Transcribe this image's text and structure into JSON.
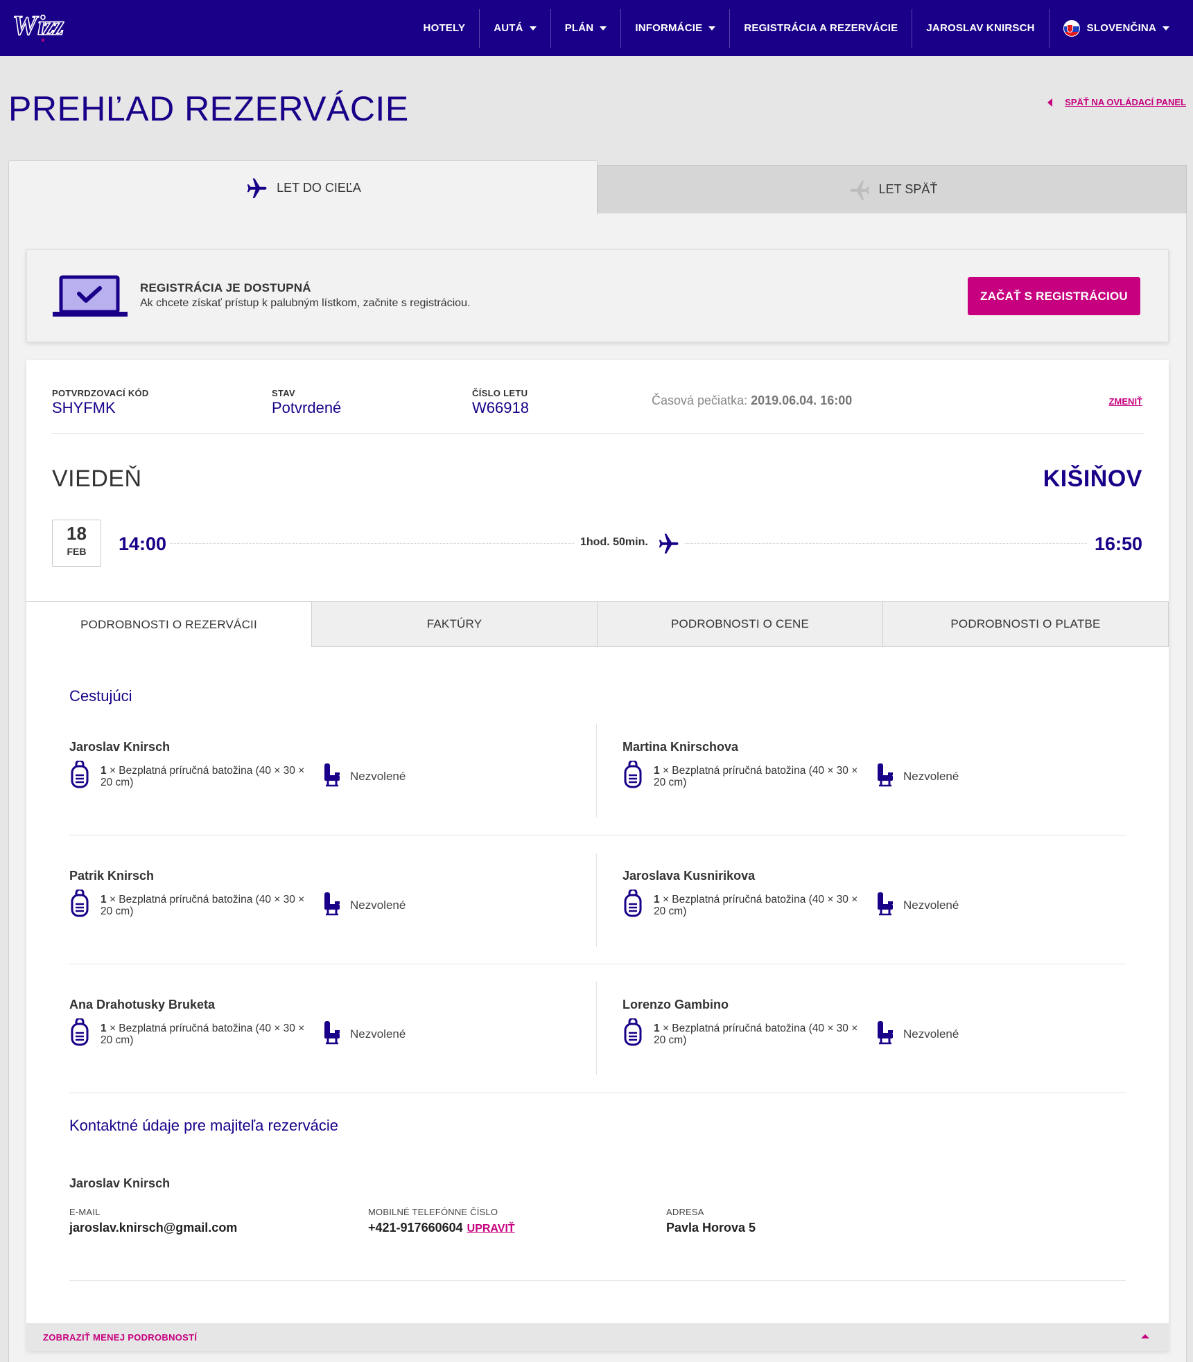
{
  "nav": {
    "logo_text": "Wizz",
    "items": [
      "HOTELY",
      "AUTÁ",
      "PLÁN",
      "INFORMÁCIE",
      "REGISTRÁCIA A REZERVÁCIE",
      "JAROSLAV KNIRSCH"
    ],
    "language": "SLOVENČINA"
  },
  "page": {
    "title": "PREHĽAD REZERVÁCIE",
    "back_link": "SPÄŤ NA OVLÁDACÍ PANEL"
  },
  "flight_tabs": {
    "outbound": "LET DO CIEĽA",
    "return": "LET SPÄŤ"
  },
  "checkin": {
    "title": "REGISTRÁCIA JE DOSTUPNÁ",
    "subtitle": "Ak chcete získať prístup k palubným lístkom, začnite s registráciou.",
    "button": "ZAČAŤ S REGISTRÁCIOU"
  },
  "booking": {
    "code_label": "POTVRDZOVACÍ KÓD",
    "code": "SHYFMK",
    "status_label": "STAV",
    "status": "Potvrdené",
    "flight_label": "ČÍSLO LETU",
    "flight": "W66918",
    "timestamp_label": "Časová pečiatka:",
    "timestamp": "2019.06.04. 16:00",
    "change_link": "ZMENIŤ"
  },
  "route": {
    "from": "VIEDEŇ",
    "to": "KIŠIŇOV",
    "day": "18",
    "month": "FEB",
    "departure": "14:00",
    "arrival": "16:50",
    "duration": "1hod. 50min."
  },
  "detail_tabs": [
    "PODROBNOSTI O REZERVÁCII",
    "FAKTÚRY",
    "PODROBNOSTI O CENE",
    "PODROBNOSTI O PLATBE"
  ],
  "passengers_title": "Cestujúci",
  "passengers": [
    {
      "name": "Jaroslav Knirsch",
      "bag_qty": "1",
      "bag": "× Bezplatná príručná batožina (40 × 30 × 20 cm)",
      "seat": "Nezvolené"
    },
    {
      "name": "Martina Knirschova",
      "bag_qty": "1",
      "bag": "× Bezplatná príručná batožina (40 × 30 × 20 cm)",
      "seat": "Nezvolené"
    },
    {
      "name": "Patrik Knirsch",
      "bag_qty": "1",
      "bag": "× Bezplatná príručná batožina (40 × 30 × 20 cm)",
      "seat": "Nezvolené"
    },
    {
      "name": "Jaroslava Kusnirikova",
      "bag_qty": "1",
      "bag": "× Bezplatná príručná batožina (40 × 30 × 20 cm)",
      "seat": "Nezvolené"
    },
    {
      "name": "Ana Drahotusky Bruketa",
      "bag_qty": "1",
      "bag": "× Bezplatná príručná batožina (40 × 30 × 20 cm)",
      "seat": "Nezvolené"
    },
    {
      "name": "Lorenzo Gambino",
      "bag_qty": "1",
      "bag": "× Bezplatná príručná batožina (40 × 30 × 20 cm)",
      "seat": "Nezvolené"
    }
  ],
  "contact": {
    "title": "Kontaktné údaje pre majiteľa rezervácie",
    "name": "Jaroslav Knirsch",
    "email_label": "E-MAIL",
    "email": "jaroslav.knirsch@gmail.com",
    "phone_label": "MOBILNÉ TELEFÓNNE ČÍSLO",
    "phone": "+421-917660604",
    "phone_edit": "UPRAVIŤ",
    "address_label": "ADRESA",
    "address": "Pavla Horova 5"
  },
  "footer": {
    "toggle": "ZOBRAZIŤ MENEJ PODROBNOSTÍ"
  },
  "colors": {
    "brand_navy": "#1a0088",
    "brand_magenta": "#c6007e",
    "background": "#e6e6e6"
  }
}
